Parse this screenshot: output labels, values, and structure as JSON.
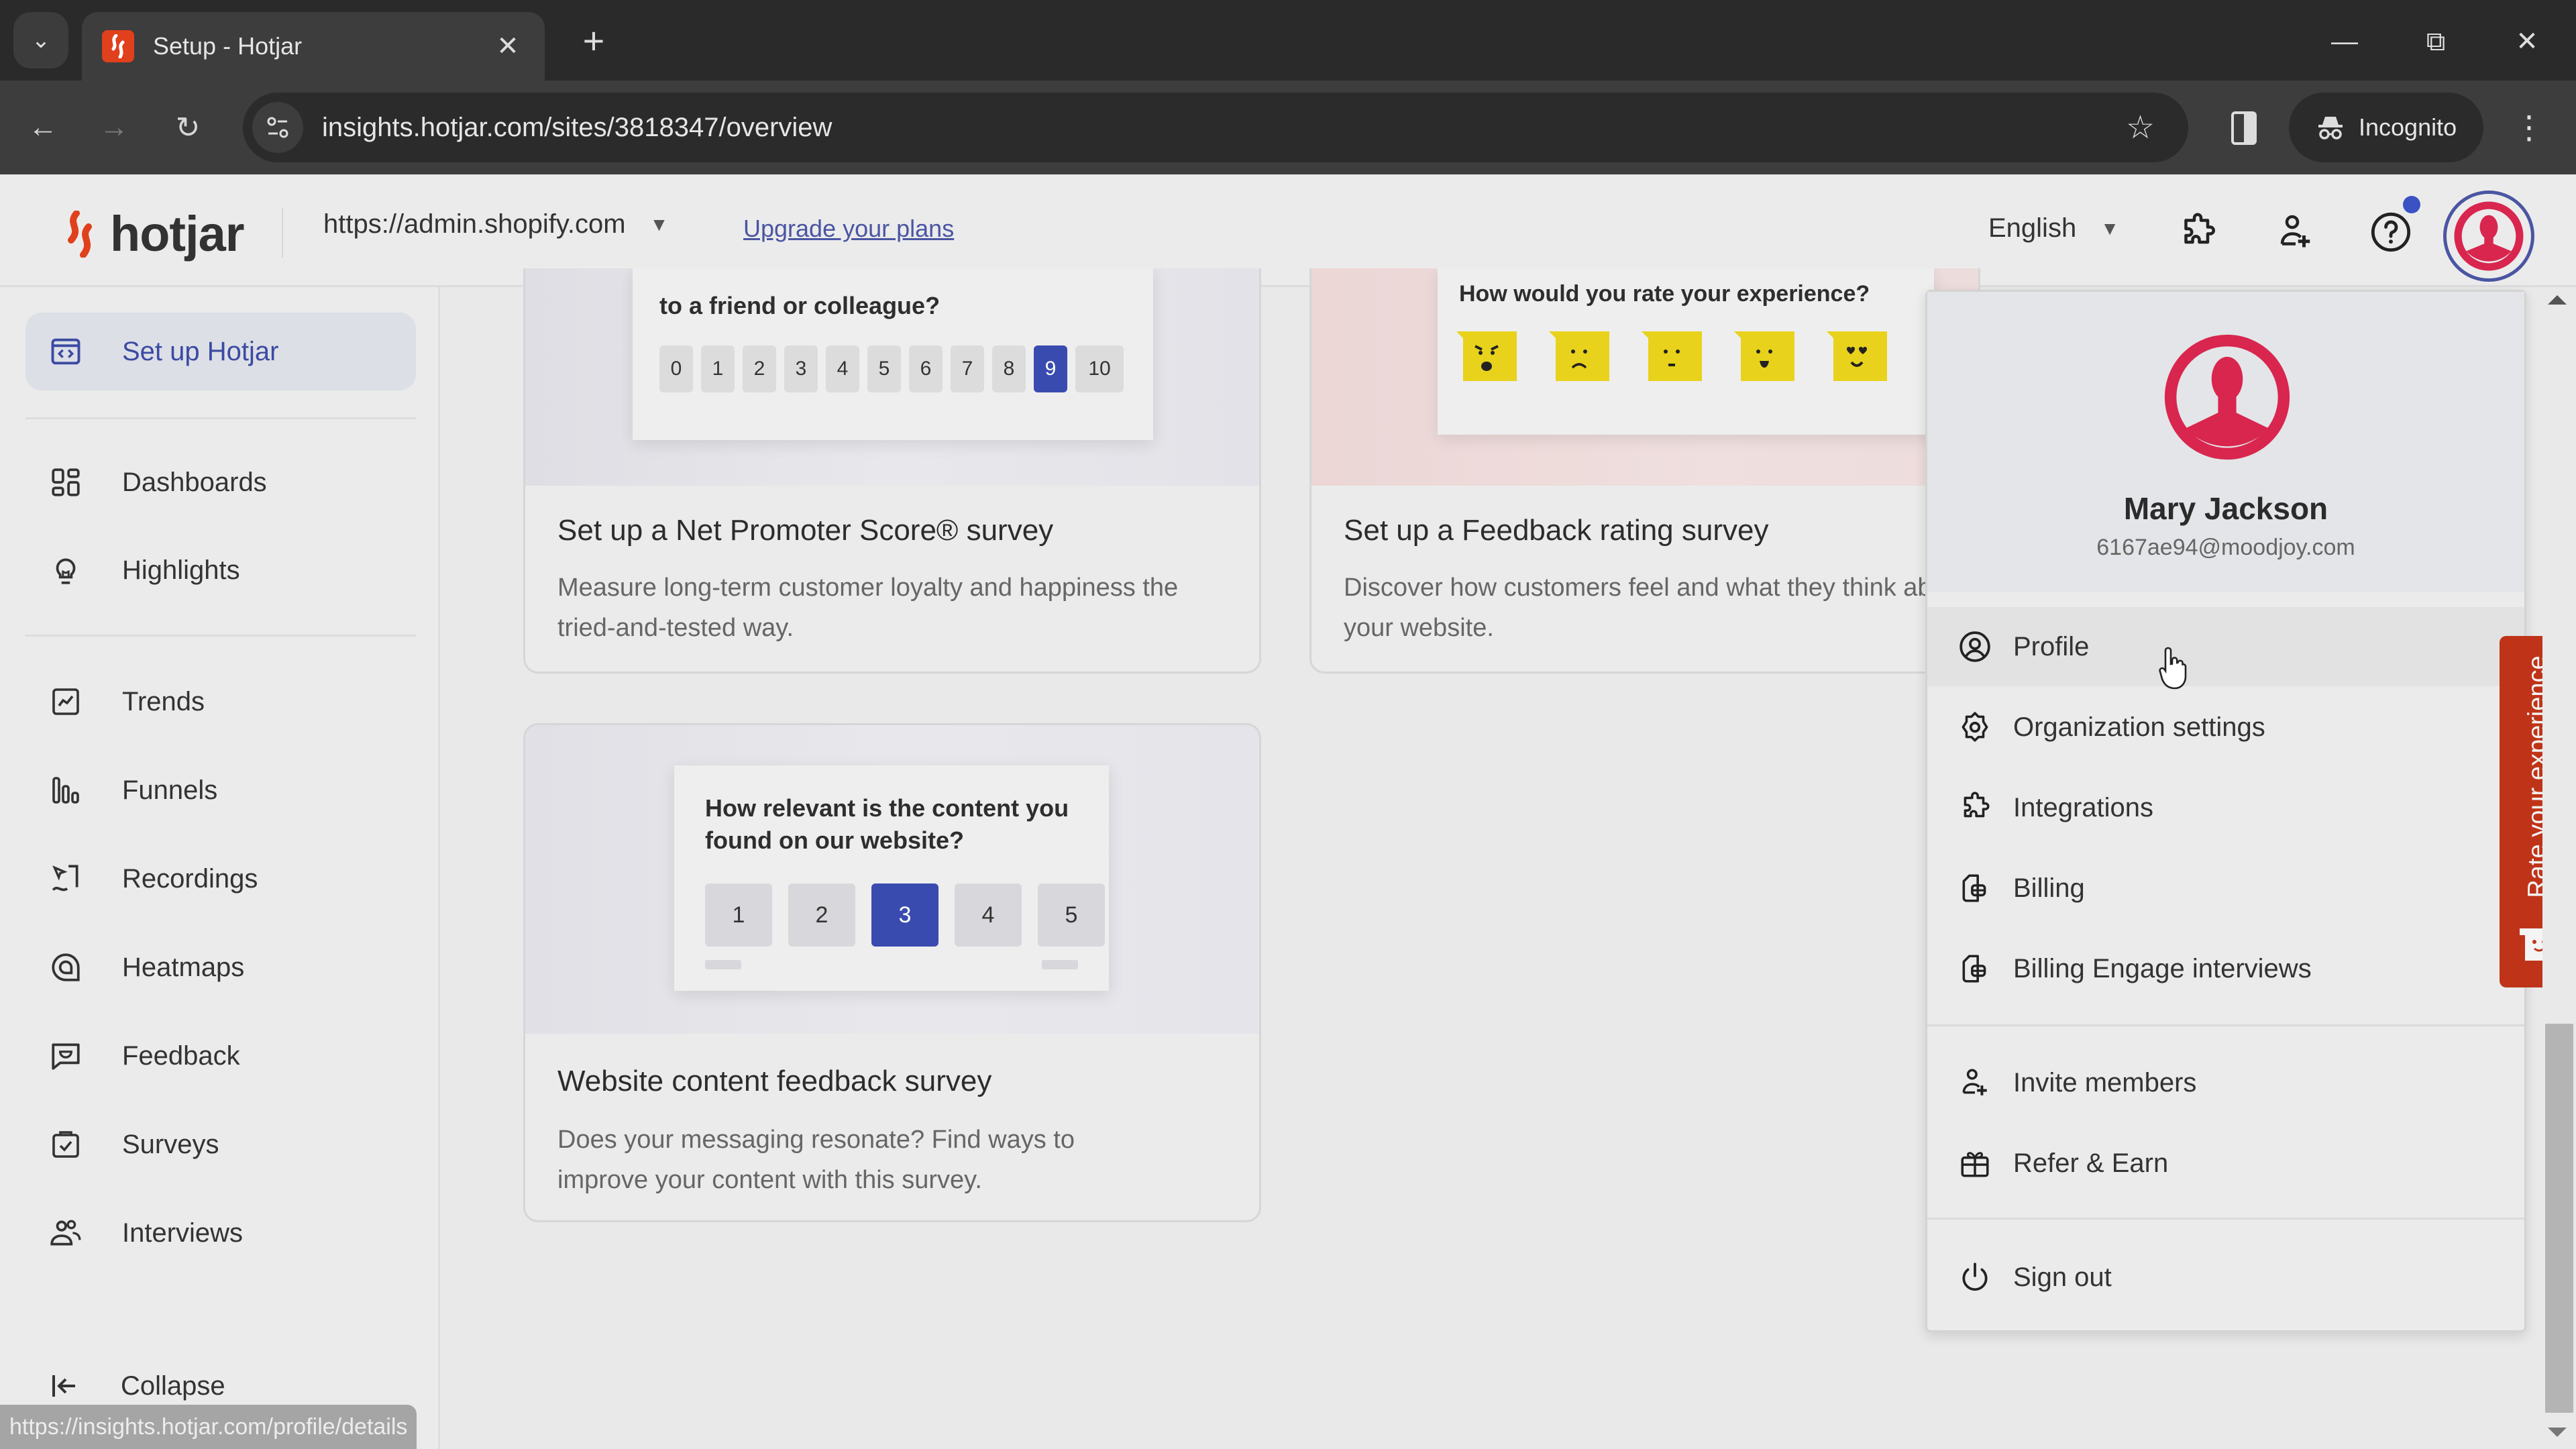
{
  "browser": {
    "tab_title": "Setup - Hotjar",
    "url": "insights.hotjar.com/sites/3818347/overview",
    "incognito_label": "Incognito",
    "status_url": "https://insights.hotjar.com/profile/details"
  },
  "header": {
    "brand": "hotjar",
    "site": "https://admin.shopify.com",
    "upgrade_link": "Upgrade your plans",
    "language": "English",
    "help_has_notification": true,
    "accent_color": "#3a4bb0",
    "brand_color": "#e0401c"
  },
  "sidebar": {
    "items": [
      {
        "label": "Set up Hotjar",
        "icon": "code-window-icon",
        "active": true
      },
      {
        "label": "Dashboards",
        "icon": "dashboard-grid-icon"
      },
      {
        "label": "Highlights",
        "icon": "lightbulb-icon"
      },
      {
        "label": "Trends",
        "icon": "trend-chart-icon"
      },
      {
        "label": "Funnels",
        "icon": "funnel-bars-icon"
      },
      {
        "label": "Recordings",
        "icon": "recording-cursor-icon"
      },
      {
        "label": "Heatmaps",
        "icon": "heatmap-icon"
      },
      {
        "label": "Feedback",
        "icon": "feedback-bubble-icon"
      },
      {
        "label": "Surveys",
        "icon": "clipboard-check-icon"
      },
      {
        "label": "Interviews",
        "icon": "people-icon"
      }
    ],
    "collapse_label": "Collapse"
  },
  "cards": {
    "nps": {
      "question": "to a friend or colleague?",
      "scale": [
        "0",
        "1",
        "2",
        "3",
        "4",
        "5",
        "6",
        "7",
        "8",
        "9",
        "10"
      ],
      "selected": "9",
      "title": "Set up a Net Promoter Score® survey",
      "description": "Measure long-term customer loyalty and happiness the tried-and-tested way."
    },
    "rating": {
      "question": "How would you rate your experience?",
      "faces": [
        "angry",
        "sad",
        "neutral",
        "happy",
        "love"
      ],
      "title": "Set up a Feedback rating survey",
      "description": "Discover how customers feel and what they think about your website."
    },
    "content": {
      "question": "How relevant is the content you found on our website?",
      "scale": [
        "1",
        "2",
        "3",
        "4",
        "5"
      ],
      "selected": "3",
      "title": "Website content feedback survey",
      "description": "Does your messaging resonate? Find ways to improve your content with this survey."
    }
  },
  "account_menu": {
    "name": "Mary Jackson",
    "email": "6167ae94@moodjoy.com",
    "avatar_color": "#d8264f",
    "items": [
      {
        "label": "Profile",
        "icon": "user-circle-icon",
        "hovered": true
      },
      {
        "label": "Organization settings",
        "icon": "gear-icon"
      },
      {
        "label": "Integrations",
        "icon": "puzzle-icon"
      },
      {
        "label": "Billing",
        "icon": "billing-icon"
      },
      {
        "label": "Billing Engage interviews",
        "icon": "billing-icon"
      },
      {
        "label": "Invite members",
        "icon": "add-user-icon"
      },
      {
        "label": "Refer & Earn",
        "icon": "gift-icon"
      },
      {
        "label": "Sign out",
        "icon": "power-icon"
      }
    ]
  },
  "feedback_tab": {
    "label": "Rate your experience",
    "color": "#bf3418"
  }
}
